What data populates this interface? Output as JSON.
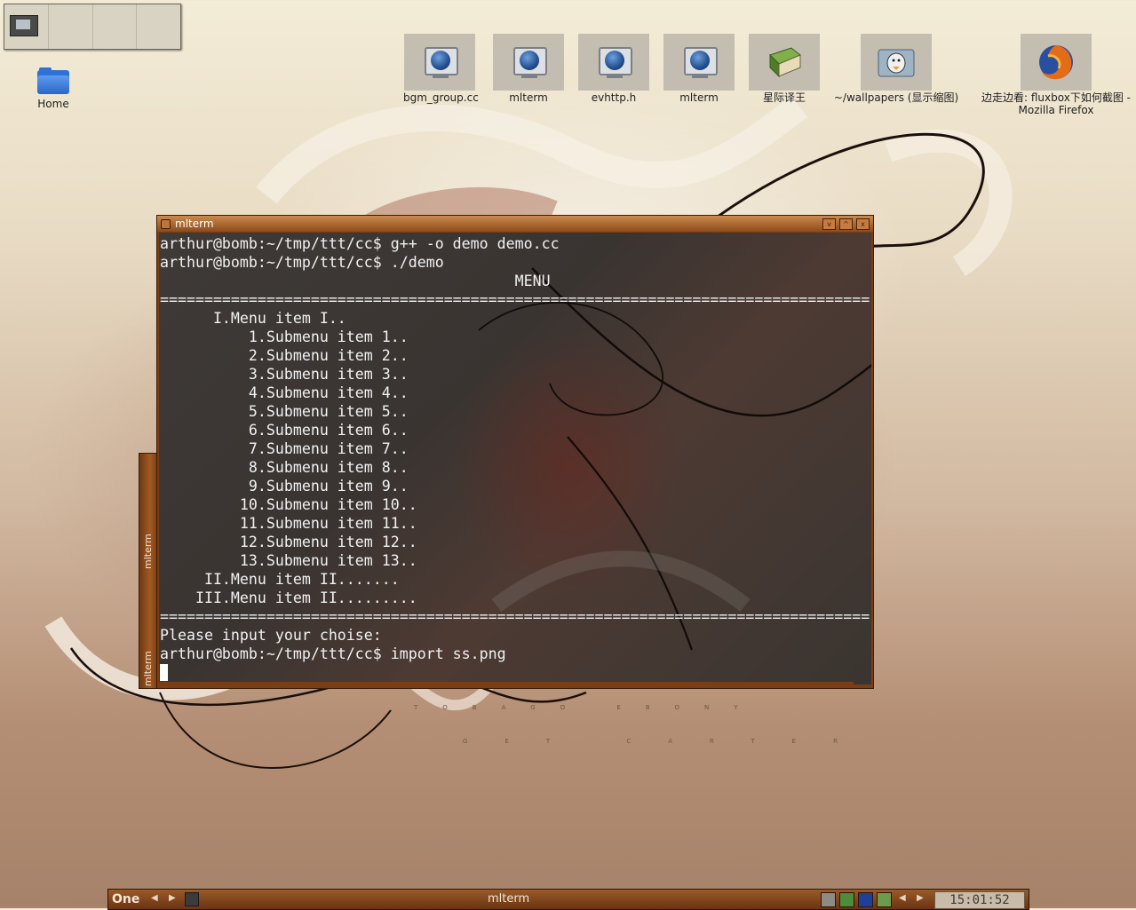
{
  "desktop": {
    "icons": [
      {
        "label": "bgm_group.cc"
      },
      {
        "label": "mlterm"
      },
      {
        "label": "evhttp.h"
      },
      {
        "label": "mlterm"
      },
      {
        "label": "星际译王"
      },
      {
        "label": "~/wallpapers (显示缩图)"
      },
      {
        "label": "边走边看: fluxbox下如何截图 - Mozilla Firefox"
      }
    ],
    "home_label": "Home",
    "tagline1": "TOBAGO EBONY",
    "tagline2": "GET CARTER"
  },
  "side_tab": {
    "labels": [
      "mlterm",
      "mlterm"
    ]
  },
  "window": {
    "title": "mlterm",
    "buttons": {
      "minimize": "v",
      "maximize": "^",
      "close": "x"
    }
  },
  "terminal": {
    "lines": [
      "arthur@bomb:~/tmp/ttt/cc$ g++ -o demo demo.cc",
      "arthur@bomb:~/tmp/ttt/cc$ ./demo",
      "                                        MENU",
      "================================================================================",
      "      I.Menu item I..",
      "          1.Submenu item 1..",
      "          2.Submenu item 2..",
      "          3.Submenu item 3..",
      "          4.Submenu item 4..",
      "          5.Submenu item 5..",
      "          6.Submenu item 6..",
      "          7.Submenu item 7..",
      "          8.Submenu item 8..",
      "          9.Submenu item 9..",
      "         10.Submenu item 10..",
      "         11.Submenu item 11..",
      "         12.Submenu item 12..",
      "         13.Submenu item 13..",
      "     II.Menu item II.......",
      "    III.Menu item II.........",
      "================================================================================",
      "Please input your choise:",
      "arthur@bomb:~/tmp/ttt/cc$ import ss.png"
    ]
  },
  "taskbar": {
    "workspace": "One",
    "task_title": "mlterm",
    "clock": "15:01:52"
  }
}
